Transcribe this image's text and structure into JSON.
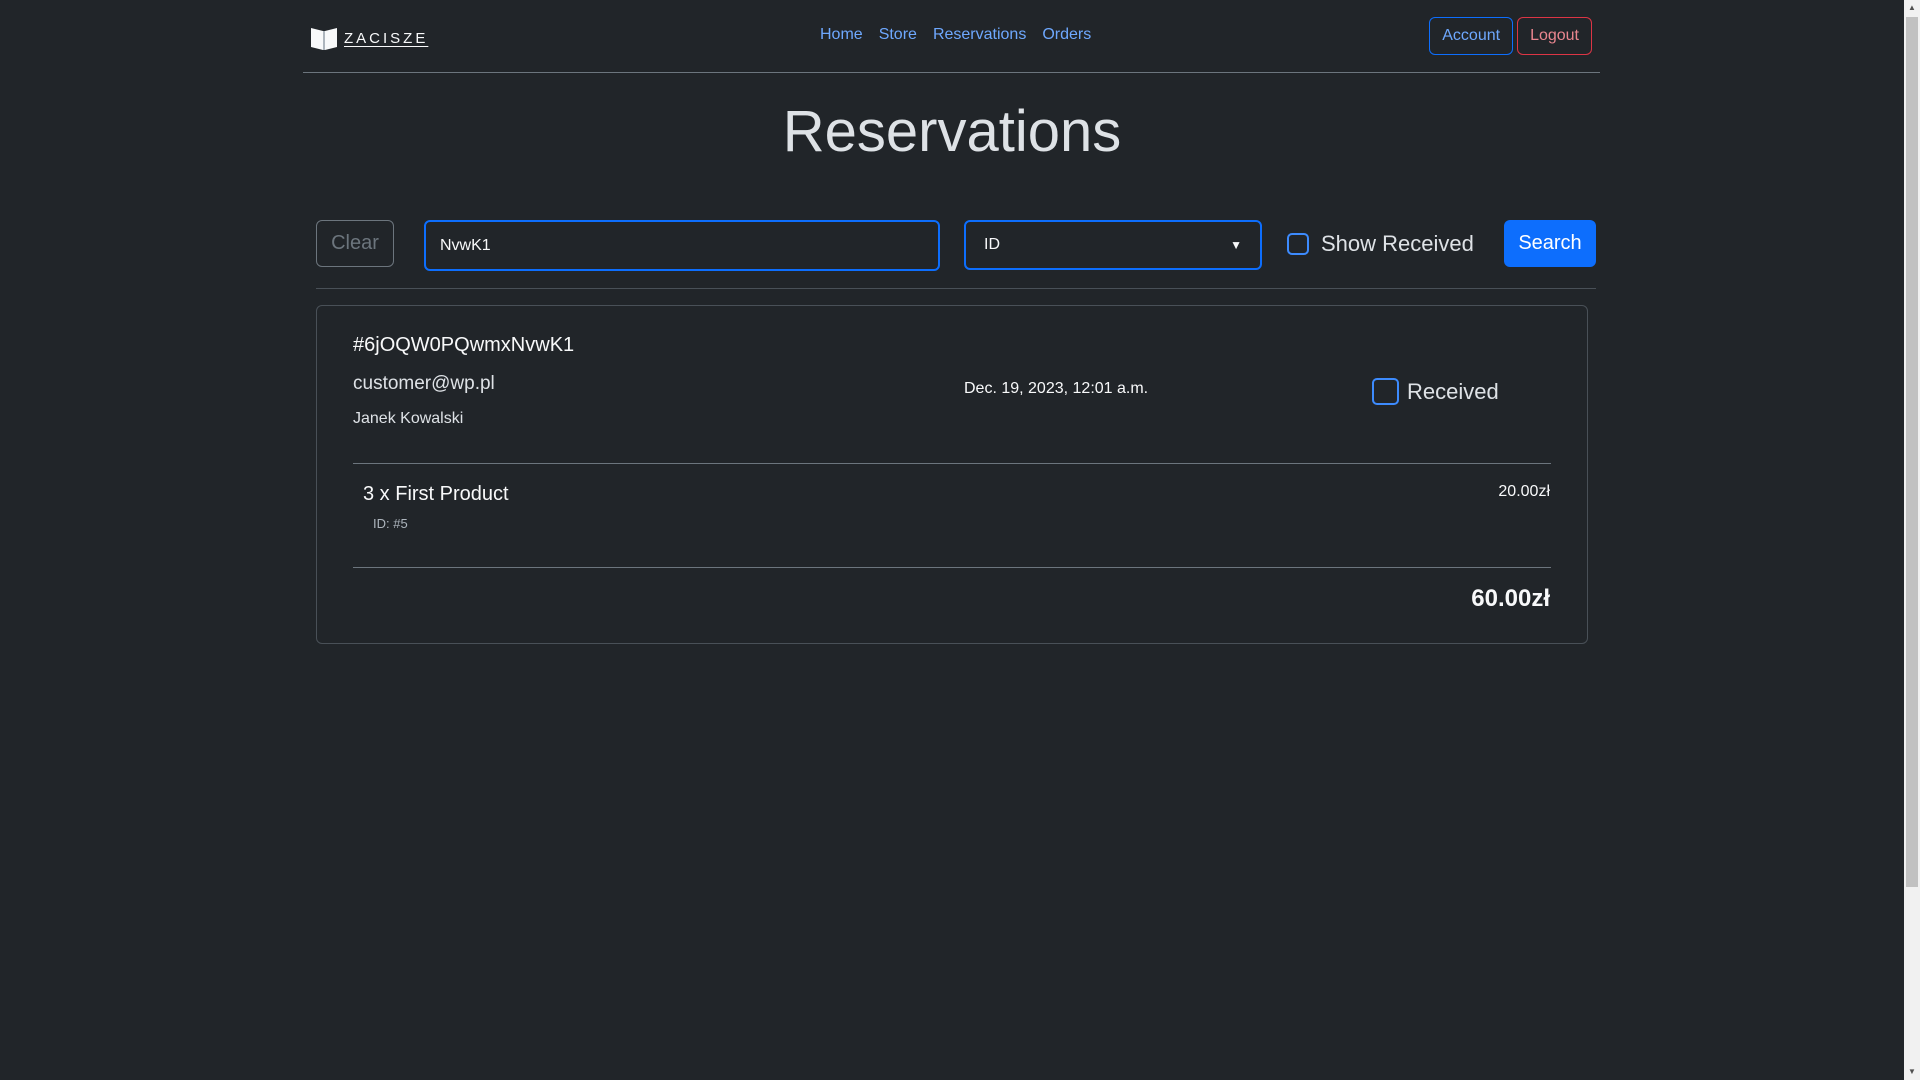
{
  "brand": {
    "name": "ZACISZE",
    "icon": "open-book-icon"
  },
  "nav": {
    "links": [
      "Home",
      "Store",
      "Reservations",
      "Orders"
    ],
    "account_label": "Account",
    "logout_label": "Logout"
  },
  "page": {
    "title": "Reservations"
  },
  "search": {
    "clear_label": "Clear",
    "query": "NvwK1",
    "field": "ID",
    "show_received_label": "Show Received",
    "show_received_checked": false,
    "search_label": "Search"
  },
  "reservation": {
    "id": "#6jOQW0PQwmxNvwK1",
    "email": "customer@wp.pl",
    "customer_name": "Janek Kowalski",
    "date": "Dec. 19, 2023, 12:01 a.m.",
    "received_label": "Received",
    "received_checked": false,
    "items": [
      {
        "title": "3 x First Product",
        "id_label": "ID: #5",
        "price": "20.00zł"
      }
    ],
    "total": "60.00zł"
  },
  "colors": {
    "background": "#212529",
    "link": "#6ea8fe",
    "primary": "#0d6efd",
    "danger": "#dc3545"
  }
}
